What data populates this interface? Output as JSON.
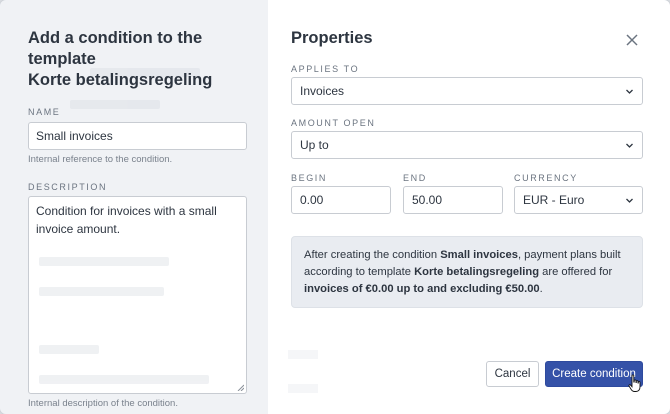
{
  "left": {
    "title_line1": "Add a condition to the template",
    "title_line2": "Korte betalingsregeling",
    "name_label": "NAME",
    "name_value": "Small invoices",
    "name_helper": "Internal reference to the condition.",
    "description_label": "DESCRIPTION",
    "description_value": "Condition for invoices with a small invoice amount.",
    "description_helper": "Internal description of the condition."
  },
  "right": {
    "title": "Properties",
    "applies_to_label": "APPLIES TO",
    "applies_to_value": "Invoices",
    "amount_open_label": "AMOUNT OPEN",
    "amount_open_value": "Up to",
    "begin_label": "BEGIN",
    "begin_value": "0.00",
    "end_label": "END",
    "end_value": "50.00",
    "currency_label": "CURRENCY",
    "currency_value": "EUR - Euro",
    "info": {
      "p1": "After creating the condition ",
      "cond_name": "Small invoices",
      "p2": ", payment plans built according to template ",
      "template_name": "Korte betalingsregeling",
      "p3": " are offered for ",
      "range": "invoices of €0.00 up to and excluding €50.00",
      "p4": "."
    },
    "cancel_label": "Cancel",
    "create_label": "Create condition"
  },
  "icons": {
    "close": "close-icon",
    "chevron": "chevron-down-icon",
    "cursor": "pointer-hand-icon"
  },
  "colors": {
    "primary": "#3552a8",
    "left_bg": "#f0f2f5",
    "info_bg": "#e9ecf1"
  }
}
